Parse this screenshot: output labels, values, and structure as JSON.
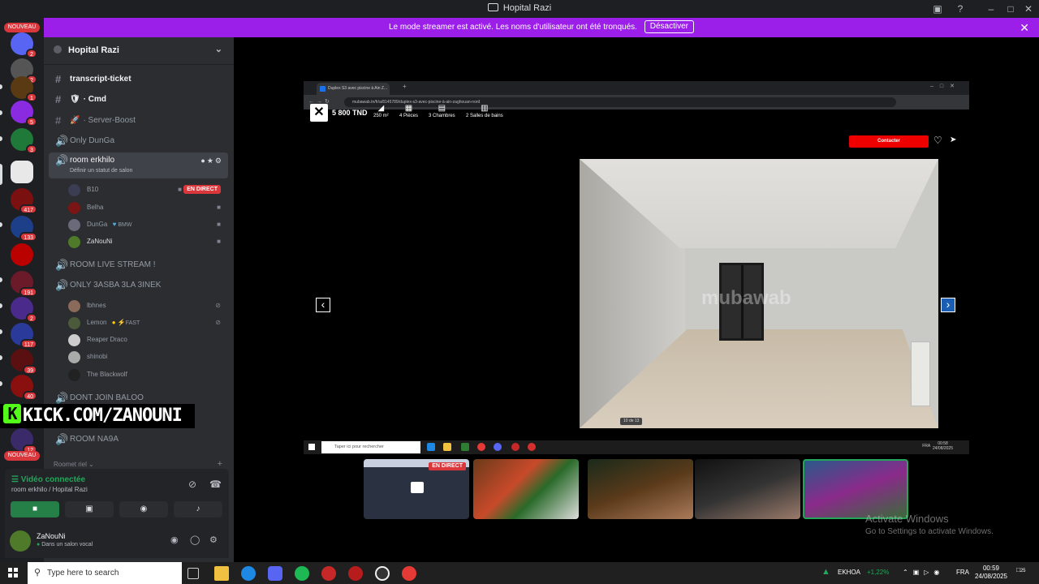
{
  "window": {
    "title": "Hopital Razi"
  },
  "banner": {
    "text": "Le mode streamer est activé. Les noms d'utilisateur ont été tronqués.",
    "button": "Désactiver"
  },
  "servers": {
    "nouveau_top": "NOUVEAU",
    "nouveau_bottom": "NOUVEAU",
    "badges": [
      "2",
      "2",
      "1",
      "5",
      "3",
      "417",
      "133",
      "191",
      "2",
      "117",
      "39",
      "40",
      "12"
    ]
  },
  "guild": {
    "name": "Hopital Razi"
  },
  "channels": [
    {
      "name": "transcript-ticket",
      "type": "text"
    },
    {
      "name": "· Cmd",
      "type": "text"
    },
    {
      "name": "· Server-Boost",
      "type": "text"
    },
    {
      "name": "Only DunGa",
      "type": "voice"
    },
    {
      "name": "room erkhilo",
      "type": "voice",
      "subtitle": "Définir un statut de salon"
    },
    {
      "name": "ROOM LIVE STREAM !",
      "type": "voice"
    },
    {
      "name": "ONLY 3ASBA 3LA 3INEK",
      "type": "voice"
    },
    {
      "name": "DONT JOIN BALOO",
      "type": "voice"
    },
    {
      "name": "ROOM NA9A",
      "type": "voice"
    }
  ],
  "room_erkhilo_users": [
    {
      "name": "B10",
      "live": "EN DIRECT"
    },
    {
      "name": "Belha"
    },
    {
      "name": "DunGa",
      "tag": "BMW"
    },
    {
      "name": "ZaNouNi"
    }
  ],
  "only3asba_users": [
    {
      "name": "lbhnes"
    },
    {
      "name": "Lemon",
      "tag": "FAST"
    },
    {
      "name": "Reaper Draco"
    },
    {
      "name": "shinobi"
    },
    {
      "name": "The Blackwolf"
    }
  ],
  "kick": {
    "text": "KICK.COM/ZANOUNI"
  },
  "category_partial": "Roomet riel",
  "voice": {
    "status": "Vidéo connectée",
    "location": "room erkhilo / Hopital Razi"
  },
  "user_panel": {
    "name": "ZaNouNi",
    "status": "Dans un salon vocal"
  },
  "browser": {
    "tab_title": "Duplex S3 avec piscine à Ain Z...",
    "url": "mubawab.tn/fr/a/8145789/duplex-s3-avec-piscine-à-ain-zaghouan-nord",
    "price": "5 800 TND",
    "features": [
      "250 m²",
      "4 Pièces",
      "3 Chambres",
      "2 Salles de bains"
    ],
    "contact": "Contacter",
    "photo_counter": "10 de 13",
    "photo_watermark": "mubawab",
    "win_search": "Taper ici pour rechercher",
    "win_lang": "FRA",
    "win_time": "00:58",
    "win_date": "24/08/2025"
  },
  "stream_tiles": [
    {
      "live": "EN DIRECT"
    }
  ],
  "activate": {
    "line1": "Activate Windows",
    "line2": "Go to Settings to activate Windows."
  },
  "taskbar": {
    "search": "Type here to search",
    "ticker": "EKHOA",
    "ticker_change": "+1,22%",
    "lang": "FRA",
    "time": "00:59",
    "date": "24/08/2025",
    "notif_count": "25"
  }
}
